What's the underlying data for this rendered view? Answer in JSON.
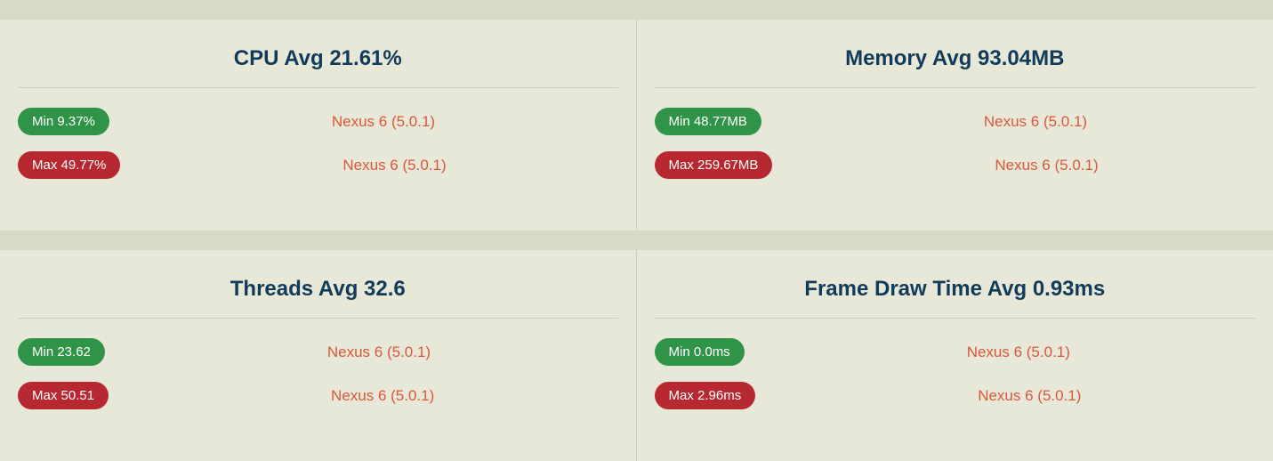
{
  "panels": [
    {
      "title": "CPU Avg 21.61%",
      "min": "Min 9.37%",
      "min_device": "Nexus 6 (5.0.1)",
      "max": "Max 49.77%",
      "max_device": "Nexus 6 (5.0.1)"
    },
    {
      "title": "Memory Avg 93.04MB",
      "min": "Min 48.77MB",
      "min_device": "Nexus 6 (5.0.1)",
      "max": "Max 259.67MB",
      "max_device": "Nexus 6 (5.0.1)"
    },
    {
      "title": "Threads Avg 32.6",
      "min": "Min 23.62",
      "min_device": "Nexus 6 (5.0.1)",
      "max": "Max 50.51",
      "max_device": "Nexus 6 (5.0.1)"
    },
    {
      "title": "Frame Draw Time Avg 0.93ms",
      "min": "Min 0.0ms",
      "min_device": "Nexus 6 (5.0.1)",
      "max": "Max 2.96ms",
      "max_device": "Nexus 6 (5.0.1)"
    }
  ]
}
